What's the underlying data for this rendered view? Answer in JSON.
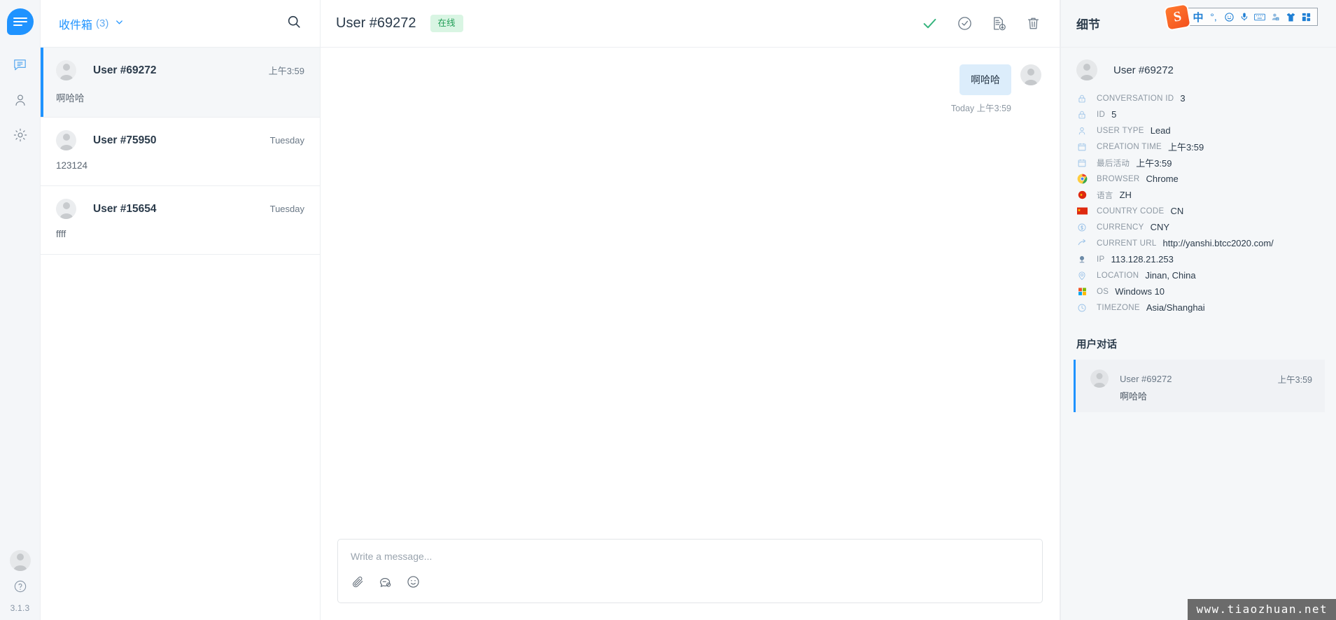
{
  "rail": {
    "logo_icon": "chat-logo-icon",
    "items": [
      {
        "icon": "conversations-icon",
        "name": "conversations",
        "active": true
      },
      {
        "icon": "contacts-icon",
        "name": "contacts",
        "active": false
      },
      {
        "icon": "settings-gear-icon",
        "name": "settings",
        "active": false
      }
    ],
    "avatar_icon": "user-avatar-icon",
    "help_icon": "help-circle-icon",
    "version": "3.1.3"
  },
  "inbox": {
    "label": "收件箱",
    "count": "(3)",
    "chevron_icon": "chevron-down-icon",
    "search_icon": "search-icon",
    "conversations": [
      {
        "name": "User #69272",
        "time": "上午3:59",
        "preview": "啊哈哈",
        "active": true
      },
      {
        "name": "User #75950",
        "time": "Tuesday",
        "preview": "123124",
        "active": false
      },
      {
        "name": "User #15654",
        "time": "Tuesday",
        "preview": "ffff",
        "active": false
      }
    ]
  },
  "chat": {
    "title": "User #69272",
    "status": "在线",
    "actions": [
      {
        "icon": "resolve-check-icon",
        "name": "resolve-conversation"
      },
      {
        "icon": "snooze-clock-icon",
        "name": "snooze-conversation"
      },
      {
        "icon": "transcript-download-icon",
        "name": "download-transcript"
      },
      {
        "icon": "trash-icon",
        "name": "delete-conversation"
      }
    ],
    "messages": [
      {
        "text": "啊哈哈",
        "meta": "Today 上午3:59",
        "side": "right"
      }
    ],
    "composer": {
      "placeholder": "Write a message...",
      "tools": [
        {
          "icon": "attachment-paperclip-icon",
          "name": "attach-file"
        },
        {
          "icon": "canned-response-icon",
          "name": "canned-response"
        },
        {
          "icon": "emoji-smiley-icon",
          "name": "emoji-picker"
        }
      ]
    }
  },
  "details": {
    "title": "细节",
    "user_name": "User #69272",
    "attributes": [
      {
        "icon": "lock-icon",
        "key": "CONVERSATION ID",
        "value": "3"
      },
      {
        "icon": "lock-icon",
        "key": "ID",
        "value": "5"
      },
      {
        "icon": "user-icon",
        "key": "USER TYPE",
        "value": "Lead"
      },
      {
        "icon": "calendar-icon",
        "key": "CREATION TIME",
        "value": "上午3:59"
      },
      {
        "icon": "calendar-icon",
        "key": "最后活动",
        "value": "上午3:59"
      },
      {
        "icon": "chrome-browser-icon",
        "key": "BROWSER",
        "value": "Chrome"
      },
      {
        "icon": "china-flag-round-icon",
        "key": "语言",
        "value": "ZH"
      },
      {
        "icon": "china-flag-icon",
        "key": "COUNTRY CODE",
        "value": "CN"
      },
      {
        "icon": "currency-icon",
        "key": "CURRENCY",
        "value": "CNY"
      },
      {
        "icon": "arrow-link-icon",
        "key": "CURRENT URL",
        "value": "http://yanshi.btcc2020.com/"
      },
      {
        "icon": "network-ip-icon",
        "key": "IP",
        "value": "113.128.21.253"
      },
      {
        "icon": "map-pin-icon",
        "key": "LOCATION",
        "value": "Jinan, China"
      },
      {
        "icon": "windows-logo-icon",
        "key": "OS",
        "value": "Windows 10"
      },
      {
        "icon": "clock-icon",
        "key": "TIMEZONE",
        "value": "Asia/Shanghai"
      }
    ],
    "user_conversations_title": "用户对话",
    "user_conversations": [
      {
        "name": "User #69272",
        "time": "上午3:59",
        "preview": "啊哈哈"
      }
    ]
  },
  "ime": {
    "logo": "S",
    "items": [
      {
        "icon": "chinese-mode-icon",
        "glyph": "中"
      },
      {
        "icon": "punctuation-mode-icon",
        "glyph": "°,"
      },
      {
        "icon": "emoji-face-icon",
        "glyph": "☺"
      },
      {
        "icon": "voice-mic-icon",
        "glyph": "🎤"
      },
      {
        "icon": "soft-keyboard-icon",
        "glyph": "⌨"
      },
      {
        "icon": "user-account-icon",
        "glyph": "👤"
      },
      {
        "icon": "skin-shirt-icon",
        "glyph": "👕"
      },
      {
        "icon": "toolbox-grid-icon",
        "glyph": "▦"
      }
    ]
  },
  "watermark": {
    "text": "www.tiaozhuan.net"
  },
  "colors": {
    "accent": "#1f93ff",
    "bubble": "#dcedfb",
    "status_bg": "#d9f5e3",
    "status_fg": "#1f9d55",
    "panel_bg": "#f5f7f9",
    "text": "#2b3b4b",
    "muted": "#8d98a3"
  }
}
